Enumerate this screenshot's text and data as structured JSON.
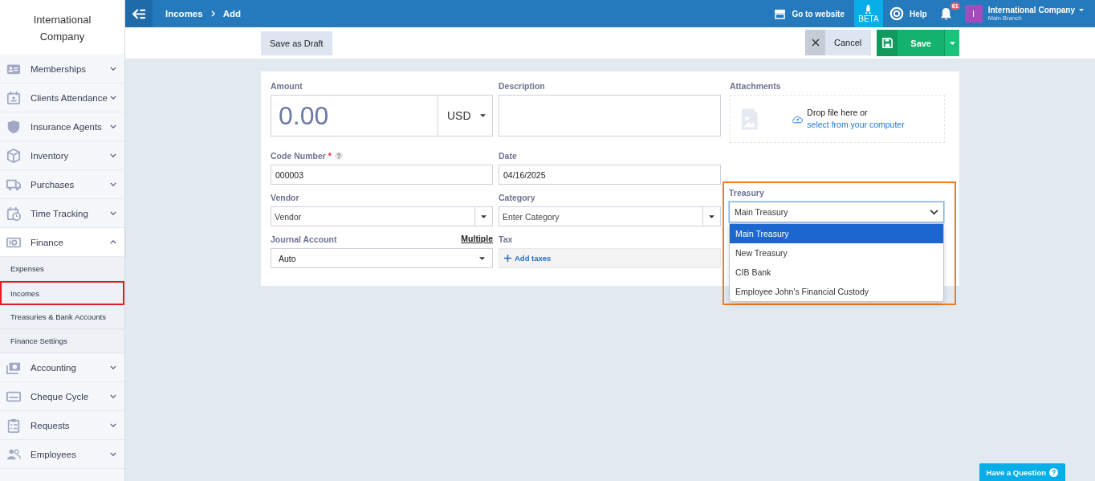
{
  "sidebar": {
    "company_name": "International Company",
    "items": [
      {
        "label": "Memberships",
        "expanded": false
      },
      {
        "label": "Clients Attendance",
        "expanded": false
      },
      {
        "label": "Insurance Agents",
        "expanded": false
      },
      {
        "label": "Inventory",
        "expanded": false
      },
      {
        "label": "Purchases",
        "expanded": false
      },
      {
        "label": "Time Tracking",
        "expanded": false
      },
      {
        "label": "Finance",
        "expanded": true,
        "children": [
          {
            "label": "Expenses",
            "selected": false
          },
          {
            "label": "Incomes",
            "selected": true
          },
          {
            "label": "Treasuries & Bank Accounts",
            "selected": false
          },
          {
            "label": "Finance Settings",
            "selected": false
          }
        ]
      },
      {
        "label": "Accounting",
        "expanded": false
      },
      {
        "label": "Cheque Cycle",
        "expanded": false
      },
      {
        "label": "Requests",
        "expanded": false
      },
      {
        "label": "Employees",
        "expanded": false
      }
    ]
  },
  "topbar": {
    "breadcrumb": [
      "Incomes",
      "Add"
    ],
    "go_to_website": "Go to website",
    "beta": "BETA",
    "help": "Help",
    "notifications": "61",
    "avatar_letter": "I",
    "account": "International Company",
    "branch": "Main Branch"
  },
  "toolbar": {
    "save_draft": "Save as Draft",
    "cancel": "Cancel",
    "save": "Save"
  },
  "form": {
    "amount": {
      "label": "Amount",
      "value": "0.00",
      "currency": "USD"
    },
    "description": {
      "label": "Description"
    },
    "attachments": {
      "label": "Attachments",
      "text": "Drop file here or",
      "link": "select from your computer"
    },
    "code_number": {
      "label": "Code Number",
      "required_mark": "*",
      "value": "000003"
    },
    "date": {
      "label": "Date",
      "value": "04/16/2025"
    },
    "vendor": {
      "label": "Vendor",
      "placeholder": "Vendor"
    },
    "category": {
      "label": "Category",
      "placeholder": "Enter Category"
    },
    "treasury": {
      "label": "Treasury",
      "value": "Main Treasury",
      "highlighted": true,
      "expanded": true,
      "options": [
        {
          "label": "Main Treasury",
          "selected": true
        },
        {
          "label": "New Treasury",
          "selected": false
        },
        {
          "label": "CIB Bank",
          "selected": false
        },
        {
          "label": "Employee John's Financial Custody",
          "selected": false
        }
      ]
    },
    "journal_account": {
      "label": "Journal Account",
      "link": "Multiple",
      "value": "Auto"
    },
    "tax": {
      "label": "Tax",
      "action": "Add taxes"
    }
  },
  "help_button": "Have a Question"
}
